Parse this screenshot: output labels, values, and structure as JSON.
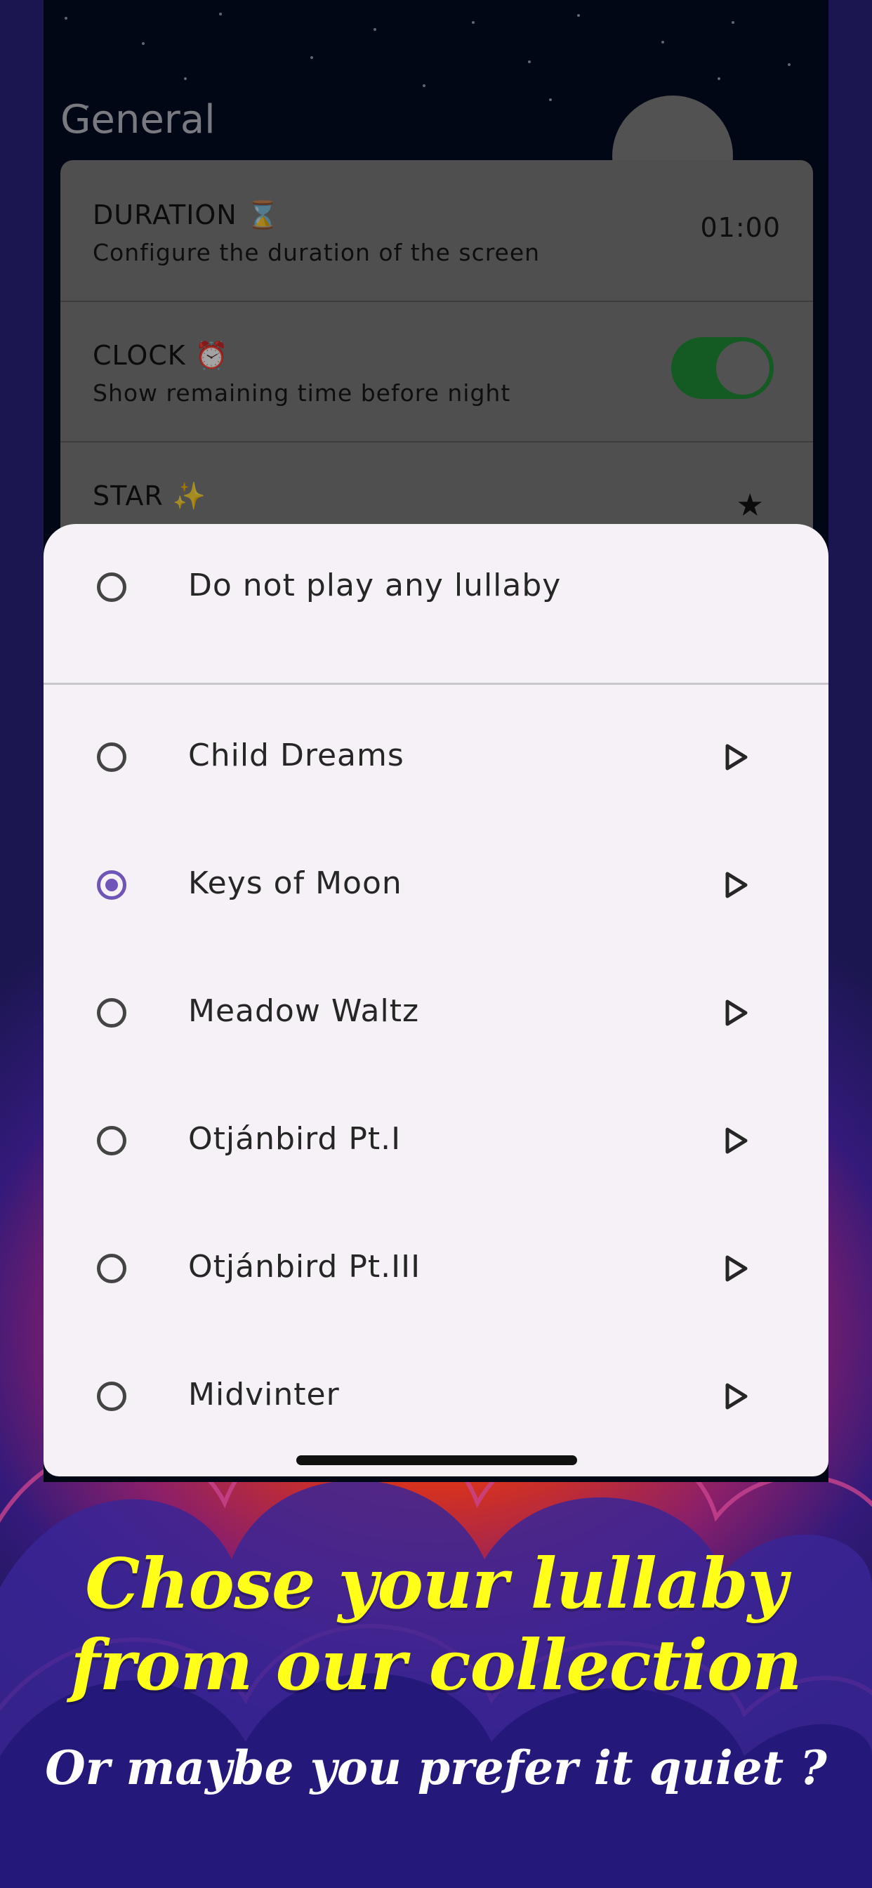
{
  "settings": {
    "section_title": "General",
    "rows": [
      {
        "title": "DURATION ⌛",
        "subtitle": "Configure the duration of the screen",
        "value": "01:00"
      },
      {
        "title": "CLOCK ⏰",
        "subtitle": "Show remaining time before night",
        "toggle_on": true
      },
      {
        "title": "STAR ✨",
        "value": "★"
      }
    ]
  },
  "lullaby_sheet": {
    "none_option": "Do not play any lullaby",
    "selected": "Keys of Moon",
    "options": [
      "Child Dreams",
      "Keys of Moon",
      "Meadow Waltz",
      "Otjánbird Pt.I",
      "Otjánbird Pt.III",
      "Midvinter"
    ]
  },
  "promo": {
    "headline_line1": "Chose your lullaby",
    "headline_line2": "from our collection",
    "tagline": "Or maybe you prefer it quiet ?"
  },
  "colors": {
    "accent": "#6f55b7",
    "toggle_on": "#1e8b36",
    "headline": "#ffff1a"
  }
}
